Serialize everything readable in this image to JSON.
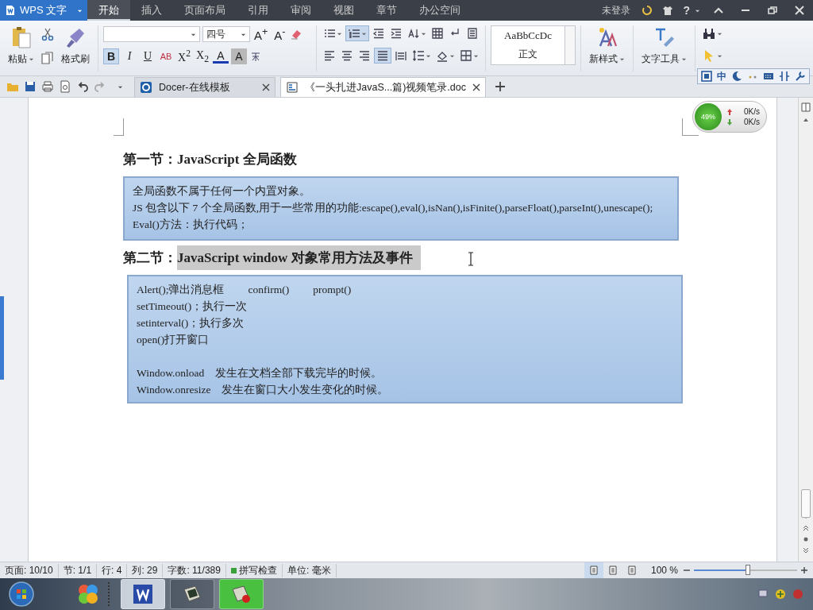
{
  "title_bar": {
    "app_menu": "WPS 文字",
    "account": "未登录",
    "help": "?",
    "tabs": [
      {
        "label": "开始",
        "selected": true
      },
      {
        "label": "插入",
        "selected": false
      },
      {
        "label": "页面布局",
        "selected": false
      },
      {
        "label": "引用",
        "selected": false
      },
      {
        "label": "审阅",
        "selected": false
      },
      {
        "label": "视图",
        "selected": false
      },
      {
        "label": "章节",
        "selected": false
      },
      {
        "label": "办公空间",
        "selected": false
      }
    ]
  },
  "ribbon": {
    "paste": "粘贴",
    "format_painter": "格式刷",
    "font_size": "四号",
    "size_buttons": [
      "A$^{+}$",
      "A$^{-}$"
    ],
    "format_buttons": [
      {
        "kind": "bold",
        "label": "B",
        "selected": true
      },
      {
        "kind": "italic",
        "label": "I",
        "selected": false
      },
      {
        "kind": "underline",
        "label": "U",
        "selected": false
      },
      {
        "kind": "strike",
        "label": "AB",
        "selected": false
      },
      {
        "kind": "plain",
        "label": "X$^{2}$",
        "selected": false
      },
      {
        "kind": "plain",
        "label": "X$_{2}$",
        "selected": false
      },
      {
        "kind": "color",
        "label": "A",
        "selected": false
      },
      {
        "kind": "shade",
        "label": "A",
        "selected": false
      }
    ],
    "list_buttons": [
      {
        "selected": false
      },
      {
        "selected": true
      }
    ],
    "align_buttons": [
      {
        "selected": false
      },
      {
        "selected": false
      },
      {
        "selected": false
      },
      {
        "selected": true
      },
      {
        "selected": false
      }
    ],
    "style_preview": "AaBbCcDc",
    "style_name": "正文",
    "new_style": "新样式",
    "text_tools": "文字工具",
    "ime_label": "中"
  },
  "doc_tabs": [
    {
      "label": "Docer-在线模板",
      "selected": false
    },
    {
      "label": "《一头扎进JavaS...篇)视频笔录.doc",
      "selected": true
    }
  ],
  "net_meter": {
    "percent": "49%",
    "up": "0K/s",
    "down": "0K/s"
  },
  "document": {
    "sections": [
      {
        "prefix": "第一节：",
        "title": "JavaScript 全局函数",
        "highlighted": false,
        "groups": [
          [
            [
              "全局函数不属于任何一个内置对象。"
            ],
            [
              "JS 包含以下 7 个全局函数,用于一些常用的功能:escape(),eval(),isNan(),isFinite(),parseFloat(),parseInt(),unescape();"
            ],
            [
              "Eval()方法：执行代码；"
            ]
          ]
        ]
      },
      {
        "prefix": "第二节：",
        "title": "JavaScript window 对象常用方法及事件",
        "highlighted": true,
        "groups": [
          [
            [
              "Alert();弹出消息框",
              "confirm()",
              "prompt()"
            ],
            [
              "setTimeout()；执行一次"
            ],
            [
              "setinterval()；执行多次"
            ],
            [
              "open()打开窗口"
            ]
          ],
          [
            [
              "Window.onload",
              "发生在文档全部下载完毕的时候。"
            ],
            [
              "Window.onresize",
              "发生在窗口大小发生变化的时候。"
            ]
          ]
        ]
      }
    ]
  },
  "status_bar": {
    "items": [
      "页面: 10/10",
      "节: 1/1",
      "行: 4",
      "列: 29",
      "字数: 11/389"
    ],
    "spell_check": {
      "label": "拼写检查",
      "on": true
    },
    "unit": "单位: 毫米",
    "views": [
      {
        "selected": true
      },
      {
        "selected": false
      },
      {
        "selected": false
      }
    ],
    "zoom": "100 %",
    "zoom_slider": {
      "level": 0.52
    }
  },
  "taskbar": {
    "buttons": [
      {
        "kind": "writer",
        "selected": true
      },
      {
        "kind": "terminal",
        "selected": false
      },
      {
        "kind": "recorder",
        "selected": true
      }
    ]
  }
}
